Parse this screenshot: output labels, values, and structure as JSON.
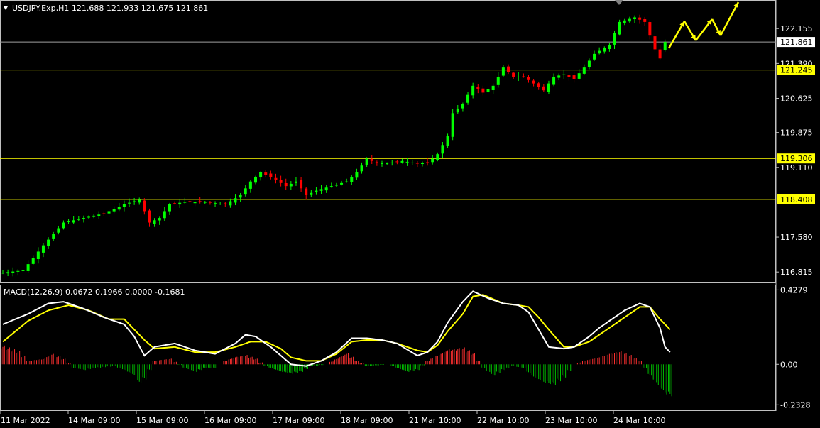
{
  "colors": {
    "background": "#000000",
    "frame": "#c0c0c0",
    "text": "#ffffff",
    "level_line": "#ffff00",
    "current_price_line": "#a0a0a0",
    "bull_candle": "#00ff00",
    "bear_candle": "#ff0000",
    "macd_line": "#ffffff",
    "signal_line": "#ffff00",
    "hist_positive": "#ff3030",
    "hist_negative": "#00c000",
    "arrow": "#ffff00"
  },
  "header": {
    "title": "USDJPY.Exp,H1  121.688 121.933 121.675 121.861",
    "macd_title": "MACD(12,26,9) 0.0672 0.1966 0.0000 -0.1681"
  },
  "chart_data": [
    {
      "type": "candlestick",
      "title": "USDJPY.Exp,H1",
      "ohlc_last": {
        "open": 121.688,
        "high": 121.933,
        "low": 121.675,
        "close": 121.861
      },
      "ylim": [
        116.6,
        122.75
      ],
      "y_ticks": [
        116.815,
        117.58,
        119.11,
        119.875,
        120.625,
        121.39,
        122.155
      ],
      "current_price": 121.861,
      "horizontal_levels": [
        121.245,
        119.306,
        118.408
      ],
      "x_ticks": [
        "11 Mar 2022",
        "14 Mar 09:00",
        "15 Mar 09:00",
        "16 Mar 09:00",
        "17 Mar 09:00",
        "18 Mar 09:00",
        "21 Mar 10:00",
        "22 Mar 10:00",
        "23 Mar 10:00",
        "24 Mar 10:00"
      ],
      "close_path": [
        [
          0,
          116.8
        ],
        [
          4,
          116.85
        ],
        [
          8,
          117.4
        ],
        [
          12,
          117.9
        ],
        [
          16,
          118.0
        ],
        [
          20,
          118.1
        ],
        [
          24,
          118.3
        ],
        [
          27,
          118.4
        ],
        [
          29,
          117.9
        ],
        [
          31,
          118.0
        ],
        [
          33,
          118.3
        ],
        [
          36,
          118.35
        ],
        [
          40,
          118.35
        ],
        [
          44,
          118.3
        ],
        [
          47,
          118.5
        ],
        [
          49,
          118.8
        ],
        [
          51,
          119.0
        ],
        [
          53,
          118.9
        ],
        [
          56,
          118.7
        ],
        [
          58,
          118.8
        ],
        [
          60,
          118.5
        ],
        [
          62,
          118.6
        ],
        [
          65,
          118.7
        ],
        [
          68,
          118.8
        ],
        [
          70,
          119.0
        ],
        [
          72,
          119.3
        ],
        [
          74,
          119.2
        ],
        [
          76,
          119.2
        ],
        [
          79,
          119.25
        ],
        [
          82,
          119.2
        ],
        [
          84,
          119.2
        ],
        [
          86,
          119.4
        ],
        [
          88,
          119.8
        ],
        [
          89,
          120.3
        ],
        [
          91,
          120.5
        ],
        [
          93,
          120.9
        ],
        [
          95,
          120.75
        ],
        [
          97,
          120.9
        ],
        [
          99,
          121.3
        ],
        [
          101,
          121.1
        ],
        [
          103,
          121.1
        ],
        [
          105,
          120.95
        ],
        [
          107,
          120.8
        ],
        [
          109,
          121.1
        ],
        [
          111,
          121.15
        ],
        [
          113,
          121.05
        ],
        [
          115,
          121.3
        ],
        [
          117,
          121.6
        ],
        [
          120,
          121.8
        ],
        [
          122,
          122.3
        ],
        [
          125,
          122.4
        ],
        [
          127,
          122.3
        ],
        [
          129,
          121.7
        ],
        [
          130,
          121.5
        ],
        [
          131,
          121.86
        ]
      ],
      "forecast_arrows": true
    },
    {
      "type": "line",
      "title": "MACD(12,26,9)",
      "values_last": {
        "macd": 0.0672,
        "signal": 0.1966,
        "hist_pos": 0.0,
        "hist_neg": -0.1681
      },
      "ylim": [
        -0.26,
        0.45
      ],
      "y_ticks": [
        0.4279,
        0.0,
        -0.2328
      ],
      "series": [
        {
          "name": "MACD",
          "values": [
            [
              0,
              0.23
            ],
            [
              5,
              0.29
            ],
            [
              9,
              0.35
            ],
            [
              12,
              0.36
            ],
            [
              16,
              0.32
            ],
            [
              20,
              0.27
            ],
            [
              24,
              0.23
            ],
            [
              26,
              0.16
            ],
            [
              28,
              0.05
            ],
            [
              30,
              0.1
            ],
            [
              34,
              0.12
            ],
            [
              38,
              0.08
            ],
            [
              42,
              0.06
            ],
            [
              46,
              0.12
            ],
            [
              48,
              0.17
            ],
            [
              50,
              0.16
            ],
            [
              53,
              0.1
            ],
            [
              55,
              0.05
            ],
            [
              57,
              0.0
            ],
            [
              60,
              -0.01
            ],
            [
              63,
              0.02
            ],
            [
              66,
              0.07
            ],
            [
              69,
              0.15
            ],
            [
              72,
              0.15
            ],
            [
              75,
              0.14
            ],
            [
              78,
              0.12
            ],
            [
              82,
              0.05
            ],
            [
              84,
              0.07
            ],
            [
              86,
              0.13
            ],
            [
              88,
              0.24
            ],
            [
              91,
              0.36
            ],
            [
              93,
              0.42
            ],
            [
              96,
              0.38
            ],
            [
              99,
              0.35
            ],
            [
              102,
              0.34
            ],
            [
              104,
              0.3
            ],
            [
              106,
              0.2
            ],
            [
              108,
              0.1
            ],
            [
              111,
              0.09
            ],
            [
              113,
              0.1
            ],
            [
              116,
              0.16
            ],
            [
              118,
              0.21
            ],
            [
              120,
              0.25
            ],
            [
              123,
              0.31
            ],
            [
              126,
              0.35
            ],
            [
              128,
              0.33
            ],
            [
              130,
              0.21
            ],
            [
              131,
              0.1
            ],
            [
              132,
              0.07
            ]
          ]
        },
        {
          "name": "Signal",
          "values": [
            [
              0,
              0.13
            ],
            [
              5,
              0.25
            ],
            [
              9,
              0.31
            ],
            [
              13,
              0.34
            ],
            [
              17,
              0.31
            ],
            [
              21,
              0.26
            ],
            [
              24,
              0.26
            ],
            [
              26,
              0.2
            ],
            [
              28,
              0.14
            ],
            [
              30,
              0.09
            ],
            [
              34,
              0.1
            ],
            [
              38,
              0.07
            ],
            [
              42,
              0.07
            ],
            [
              46,
              0.1
            ],
            [
              49,
              0.13
            ],
            [
              52,
              0.13
            ],
            [
              55,
              0.09
            ],
            [
              57,
              0.04
            ],
            [
              60,
              0.02
            ],
            [
              63,
              0.02
            ],
            [
              66,
              0.06
            ],
            [
              69,
              0.13
            ],
            [
              72,
              0.14
            ],
            [
              75,
              0.14
            ],
            [
              78,
              0.12
            ],
            [
              82,
              0.08
            ],
            [
              84,
              0.07
            ],
            [
              86,
              0.11
            ],
            [
              88,
              0.19
            ],
            [
              91,
              0.29
            ],
            [
              93,
              0.39
            ],
            [
              95,
              0.4
            ],
            [
              99,
              0.35
            ],
            [
              102,
              0.34
            ],
            [
              104,
              0.33
            ],
            [
              106,
              0.27
            ],
            [
              108,
              0.2
            ],
            [
              111,
              0.1
            ],
            [
              113,
              0.1
            ],
            [
              116,
              0.13
            ],
            [
              118,
              0.17
            ],
            [
              120,
              0.21
            ],
            [
              123,
              0.27
            ],
            [
              126,
              0.33
            ],
            [
              128,
              0.33
            ],
            [
              130,
              0.26
            ],
            [
              132,
              0.2
            ]
          ]
        },
        {
          "name": "Histogram",
          "values": [
            [
              0,
              0.1
            ],
            [
              3,
              0.07
            ],
            [
              5,
              0.02
            ],
            [
              8,
              0.03
            ],
            [
              10,
              0.06
            ],
            [
              12,
              0.03
            ],
            [
              14,
              -0.02
            ],
            [
              16,
              -0.03
            ],
            [
              18,
              -0.02
            ],
            [
              22,
              -0.01
            ],
            [
              24,
              -0.03
            ],
            [
              26,
              -0.06
            ],
            [
              27,
              -0.1
            ],
            [
              28,
              -0.08
            ],
            [
              30,
              0.02
            ],
            [
              33,
              0.03
            ],
            [
              36,
              -0.02
            ],
            [
              38,
              -0.04
            ],
            [
              40,
              -0.02
            ],
            [
              42,
              -0.02
            ],
            [
              44,
              0.02
            ],
            [
              46,
              0.04
            ],
            [
              48,
              0.05
            ],
            [
              50,
              0.03
            ],
            [
              52,
              -0.01
            ],
            [
              55,
              -0.04
            ],
            [
              57,
              -0.05
            ],
            [
              59,
              -0.04
            ],
            [
              61,
              -0.01
            ],
            [
              64,
              0.0
            ],
            [
              66,
              0.03
            ],
            [
              68,
              0.06
            ],
            [
              70,
              0.02
            ],
            [
              72,
              -0.01
            ],
            [
              76,
              0.0
            ],
            [
              78,
              -0.02
            ],
            [
              80,
              -0.04
            ],
            [
              82,
              -0.03
            ],
            [
              84,
              0.02
            ],
            [
              86,
              0.05
            ],
            [
              88,
              0.08
            ],
            [
              91,
              0.09
            ],
            [
              93,
              0.06
            ],
            [
              95,
              -0.02
            ],
            [
              97,
              -0.06
            ],
            [
              99,
              -0.03
            ],
            [
              101,
              -0.01
            ],
            [
              103,
              -0.02
            ],
            [
              105,
              -0.07
            ],
            [
              107,
              -0.1
            ],
            [
              109,
              -0.11
            ],
            [
              111,
              -0.07
            ],
            [
              113,
              0.0
            ],
            [
              115,
              0.02
            ],
            [
              118,
              0.04
            ],
            [
              120,
              0.06
            ],
            [
              122,
              0.07
            ],
            [
              124,
              0.05
            ],
            [
              126,
              0.02
            ],
            [
              128,
              -0.06
            ],
            [
              130,
              -0.13
            ],
            [
              131,
              -0.16
            ],
            [
              132,
              -0.17
            ]
          ]
        }
      ]
    }
  ]
}
